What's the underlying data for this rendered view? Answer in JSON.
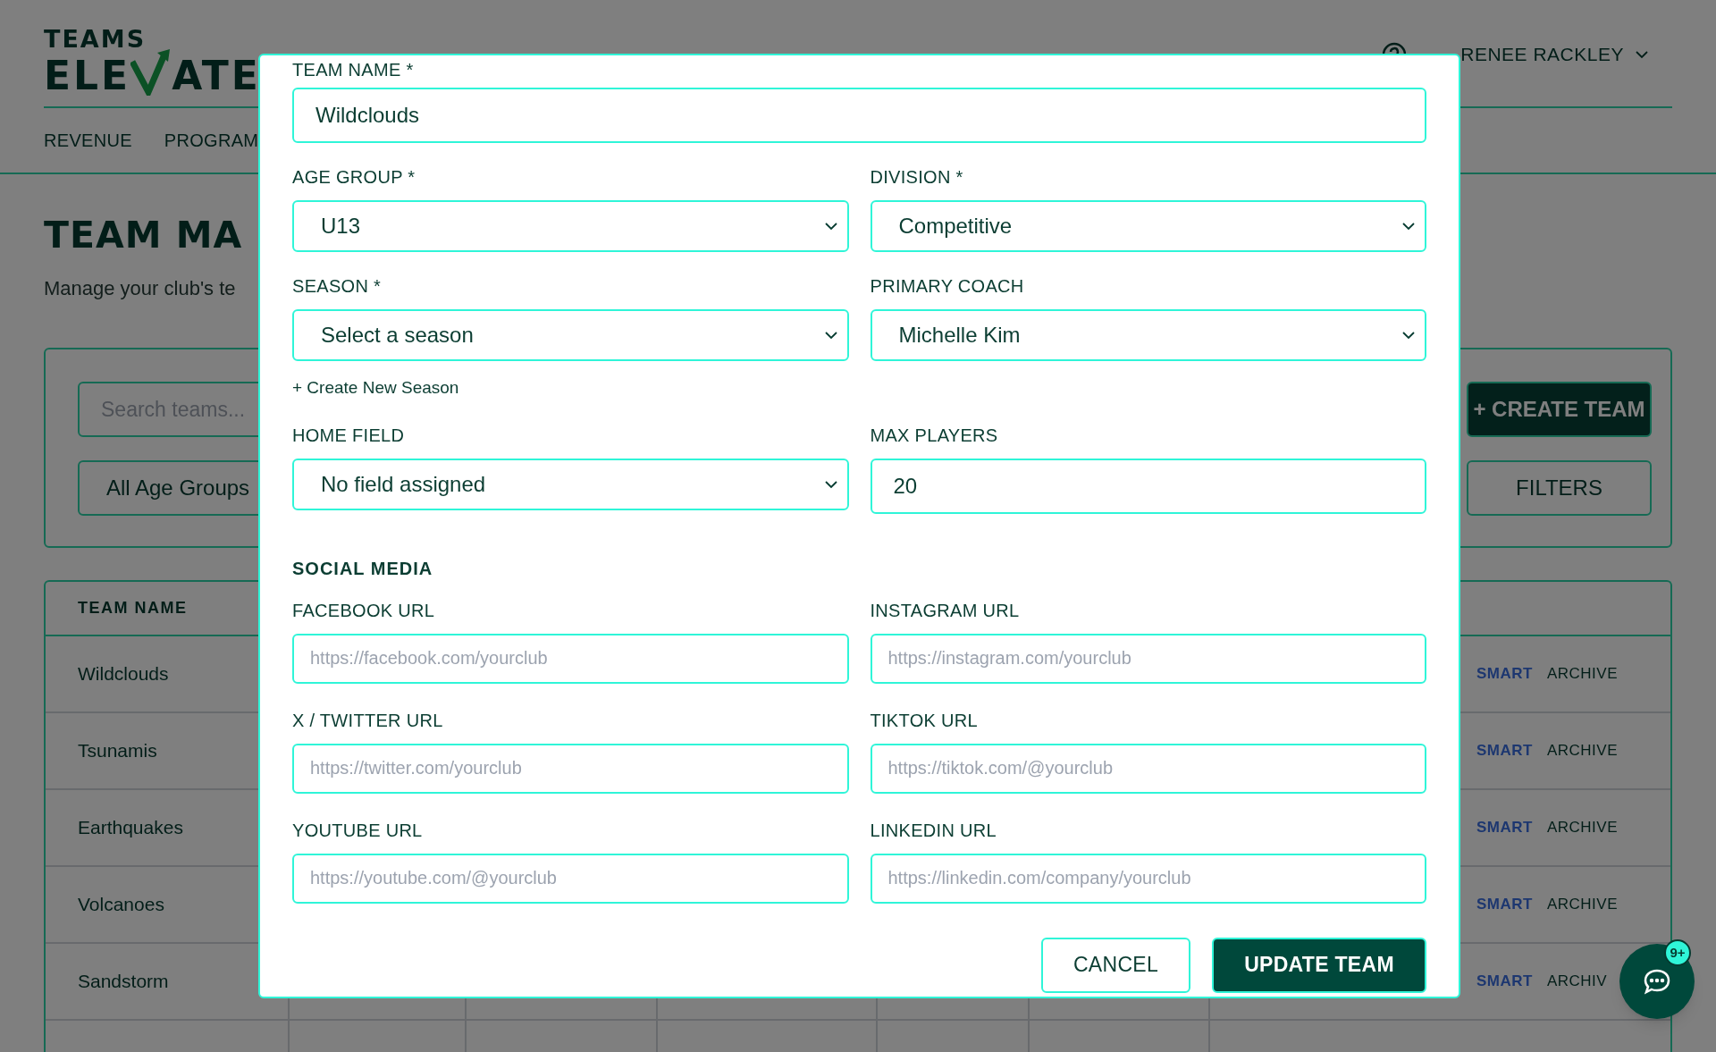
{
  "header": {
    "logo_top": "TEAMS",
    "logo_left": "ELE",
    "logo_right": "ATE",
    "user_name": "RENEE RACKLEY"
  },
  "nav": [
    "REVENUE",
    "PROGRAM"
  ],
  "page": {
    "title": "TEAM MA",
    "subtitle": "Manage your club's te"
  },
  "filters": {
    "search_placeholder": "Search teams...",
    "age_select": "All Age Groups",
    "create_button": "+ CREATE TEAM",
    "filters_button": "FILTERS"
  },
  "table": {
    "header": "TEAM NAME",
    "rows": [
      {
        "name": "Wildclouds",
        "actions": [
          "SMART",
          "ARCHIVE"
        ]
      },
      {
        "name": "Tsunamis",
        "actions": [
          "SMART",
          "ARCHIVE"
        ]
      },
      {
        "name": "Earthquakes",
        "actions": [
          "SMART",
          "ARCHIVE"
        ]
      },
      {
        "name": "Volcanoes",
        "actions": [
          "SMART",
          "ARCHIVE"
        ]
      },
      {
        "name": "Sandstorm",
        "actions": [
          "SMART",
          "ARCHIV"
        ]
      }
    ]
  },
  "modal": {
    "team_name": {
      "label": "TEAM NAME *",
      "value": "Wildclouds"
    },
    "fields": [
      {
        "kind": "select",
        "label": "AGE GROUP *",
        "value": "U13"
      },
      {
        "kind": "select",
        "label": "DIVISION *",
        "value": "Competitive"
      },
      {
        "kind": "select",
        "label": "SEASON *",
        "value": "Select a season",
        "link": "+ Create New Season"
      },
      {
        "kind": "select",
        "label": "PRIMARY COACH",
        "value": "Michelle Kim"
      },
      {
        "kind": "select",
        "label": "HOME FIELD",
        "value": "No field assigned"
      },
      {
        "kind": "text",
        "label": "MAX PLAYERS",
        "value": "20"
      }
    ],
    "social_heading": "SOCIAL MEDIA",
    "social_fields": [
      {
        "label": "FACEBOOK URL",
        "placeholder": "https://facebook.com/yourclub"
      },
      {
        "label": "INSTAGRAM URL",
        "placeholder": "https://instagram.com/yourclub"
      },
      {
        "label": "X / TWITTER URL",
        "placeholder": "https://twitter.com/yourclub"
      },
      {
        "label": "TIKTOK URL",
        "placeholder": "https://tiktok.com/@yourclub"
      },
      {
        "label": "YOUTUBE URL",
        "placeholder": "https://youtube.com/@yourclub"
      },
      {
        "label": "LINKEDIN URL",
        "placeholder": "https://linkedin.com/company/yourclub"
      }
    ],
    "buttons": [
      {
        "kind": "secondary",
        "label": "CANCEL"
      },
      {
        "kind": "primary",
        "label": "UPDATE TEAM"
      }
    ]
  },
  "chat": {
    "badge": "9+"
  }
}
